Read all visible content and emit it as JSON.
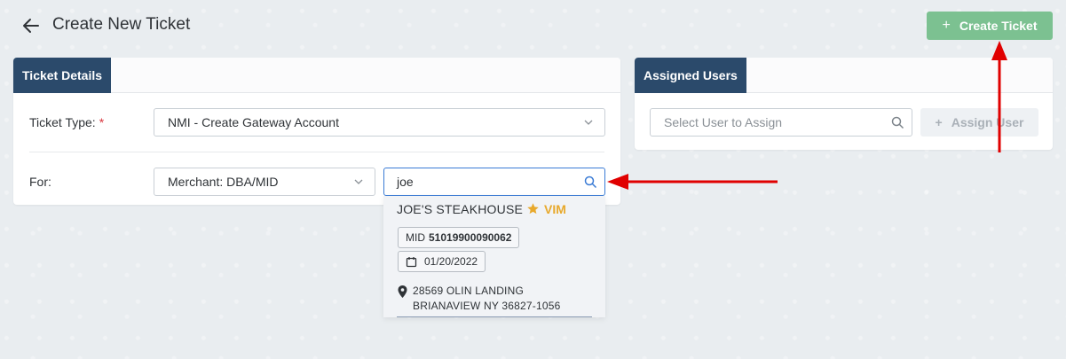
{
  "header": {
    "title": "Create New Ticket",
    "create_button": "Create Ticket"
  },
  "details_card": {
    "tab_label": "Ticket Details",
    "ticket_type_label": "Ticket Type:",
    "required_mark": "*",
    "ticket_type_value": "NMI - Create Gateway Account",
    "for_label": "For:",
    "for_value": "Merchant: DBA/MID",
    "search_value": "joe"
  },
  "assigned_card": {
    "tab_label": "Assigned Users",
    "user_placeholder": "Select User to Assign",
    "assign_button": "Assign User"
  },
  "search_result": {
    "name": "JOE'S STEAKHOUSE",
    "badge": "VIM",
    "mid_label": "MID",
    "mid_value": "51019900090062",
    "date": "01/20/2022",
    "address_line1": "28569 OLIN LANDING",
    "address_line2": "BRIANAVIEW NY 36827-1056"
  },
  "colors": {
    "tab_bg": "#2b4a6b",
    "create_button": "#7cc191",
    "annotation_arrow": "#e00000",
    "vim_badge": "#e8a92c"
  },
  "icons": [
    "back-arrow-icon",
    "plus-icon",
    "chevron-down-icon",
    "search-icon",
    "star-icon",
    "calendar-icon",
    "location-pin-icon"
  ]
}
